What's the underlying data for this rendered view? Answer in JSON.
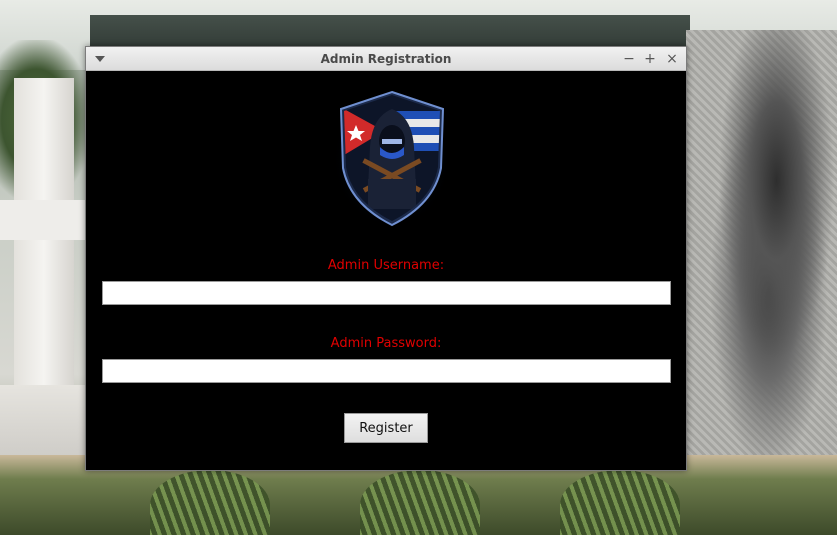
{
  "window": {
    "title": "Admin Registration",
    "controls": {
      "minimize": "−",
      "maximize": "+",
      "close": "×"
    }
  },
  "logo": {
    "icon": "hooded-figure-shield-emblem"
  },
  "form": {
    "username_label": "Admin Username:",
    "username_value": "",
    "password_label": "Admin Password:",
    "password_value": "",
    "register_label": "Register"
  },
  "colors": {
    "label": "#e00000",
    "window_bg": "#000000"
  }
}
